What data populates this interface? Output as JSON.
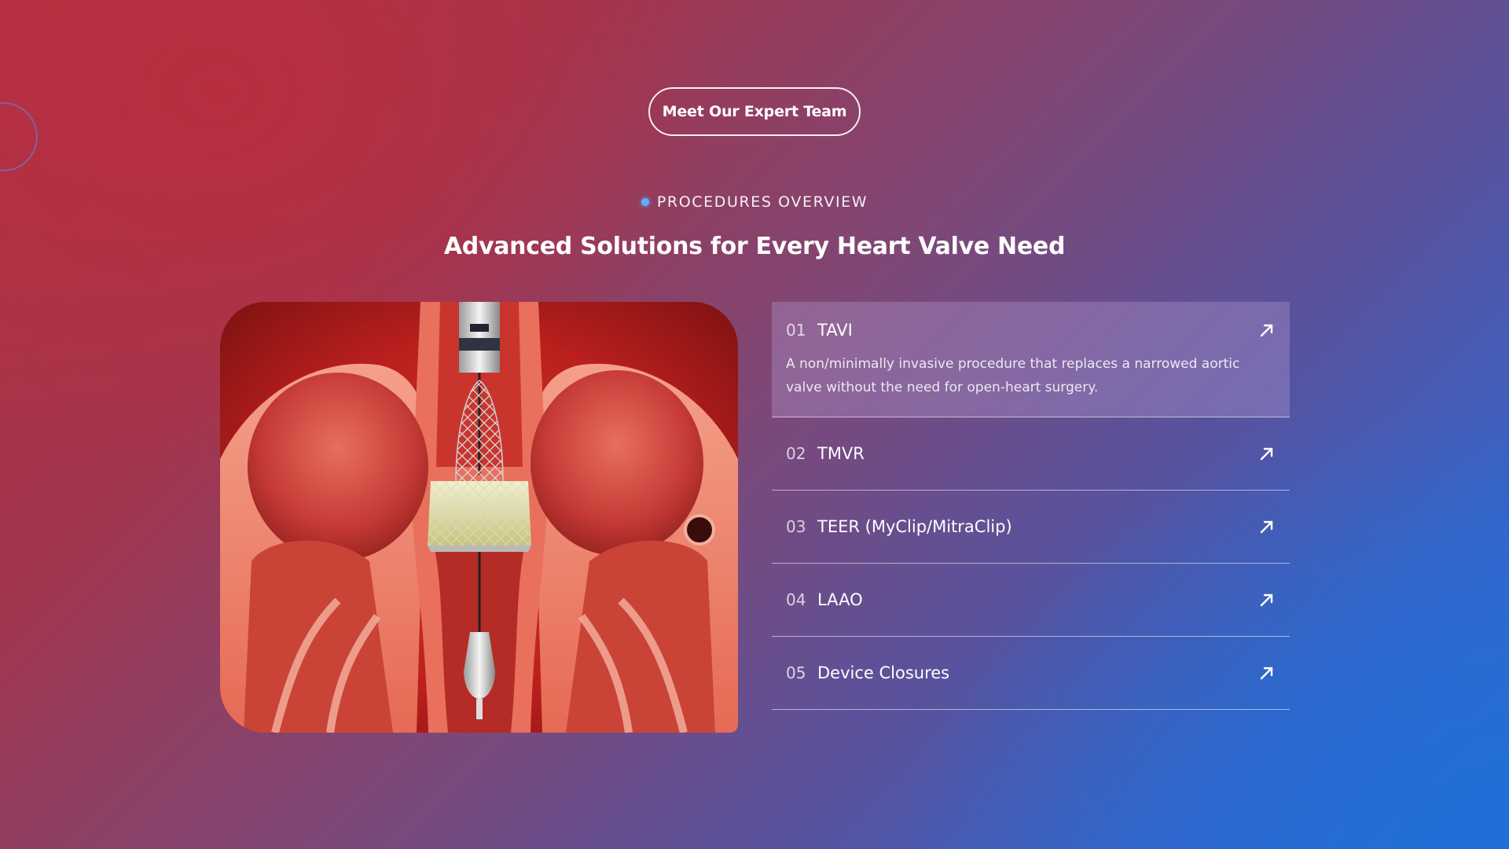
{
  "cta": {
    "label": "Meet Our Expert Team"
  },
  "section": {
    "eyebrow": "PROCEDURES OVERVIEW",
    "title": "Advanced Solutions for Every Heart Valve Need"
  },
  "hero_image": {
    "alt": "Heart cross-section with transcatheter valve"
  },
  "procedures": [
    {
      "number": "01",
      "title": "TAVI",
      "description": "A non/minimally invasive procedure that replaces a narrowed aortic valve without the need for open-heart surgery.",
      "icon": "arrow-up-right-icon"
    },
    {
      "number": "02",
      "title": "TMVR",
      "icon": "arrow-up-right-icon"
    },
    {
      "number": "03",
      "title": "TEER (MyClip/MitraClip)",
      "icon": "arrow-up-right-icon"
    },
    {
      "number": "04",
      "title": "LAAO",
      "icon": "arrow-up-right-icon"
    },
    {
      "number": "05",
      "title": "Device Closures",
      "icon": "arrow-up-right-icon"
    }
  ],
  "colors": {
    "background_red": "#b23242",
    "background_blue": "#2a6fd6",
    "eyebrow_dot": "#5cb0ff",
    "active_item_bg": "#8a7fb3"
  }
}
